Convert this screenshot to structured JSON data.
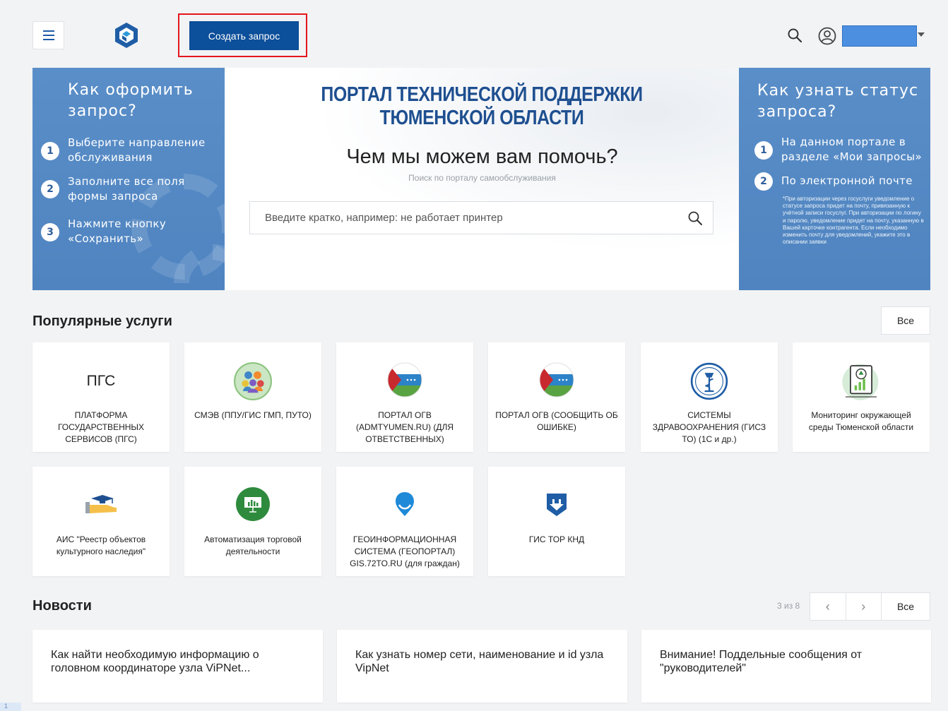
{
  "header": {
    "create_label": "Создать запрос"
  },
  "banner": {
    "left_title": "Как оформить запрос?",
    "left_steps": [
      {
        "num": "1",
        "text": "Выберите направление обслуживания"
      },
      {
        "num": "2",
        "text": "Заполните все поля формы запроса"
      },
      {
        "num": "3",
        "text": "Нажмите кнопку «Сохранить»"
      }
    ],
    "portal_title": "ПОРТАЛ ТЕХНИЧЕСКОЙ ПОДДЕРЖКИ ТЮМЕНСКОЙ ОБЛАСТИ",
    "help_title": "Чем мы можем вам помочь?",
    "help_sub": "Поиск по порталу самообслуживания",
    "search_placeholder": "Введите кратко, например: не работает принтер",
    "right_title": "Как узнать статус запроса?",
    "right_steps": [
      {
        "num": "1",
        "text": "На данном портале в разделе «Мои запросы»"
      },
      {
        "num": "2",
        "text": "По электронной почте"
      }
    ],
    "right_note": "*При авторизации через госуслуги уведомление о статусе запроса придет на почту, привязанную к учётной записи госуслуг. При авторизации по логину и паролю, уведомление придет на почту, указанную в Вашей карточке контрагента. Если необходимо изменить почту для уведомлений, укажите это в описании заявки"
  },
  "popular": {
    "title": "Популярные услуги",
    "all_label": "Все",
    "cards": [
      {
        "label": "ПЛАТФОРМА ГОСУДАРСТВЕННЫХ СЕРВИСОВ (ПГС)",
        "icon_text": "ПГС",
        "icon": "pgs-text-icon"
      },
      {
        "label": "СМЭВ (ППУ/ГИС ГМП, ПУТО)",
        "icon": "people-group-icon"
      },
      {
        "label": "ПОРТАЛ ОГВ (ADMTYUMEN.RU) (ДЛЯ ОТВЕТСТВЕННЫХ)",
        "icon": "flag-icon"
      },
      {
        "label": "ПОРТАЛ ОГВ (СООБЩИТЬ ОБ ОШИБКЕ)",
        "icon": "flag-icon"
      },
      {
        "label": "СИСТЕМЫ ЗДРАВООХРАНЕНИЯ (ГИСЗ ТО) (1С и др.)",
        "icon": "medical-icon"
      },
      {
        "label": "Мониторинг окружающей среды Тюменской области",
        "icon": "eco-monitor-icon"
      },
      {
        "label": "АИС \"Реестр объектов культурного наследия\"",
        "icon": "heritage-icon"
      },
      {
        "label": "Автоматизация торговой деятельности",
        "icon": "presentation-chart-icon"
      },
      {
        "label": "ГЕОИНФОРМАЦИОННАЯ СИСТЕМА (ГЕОПОРТАЛ) GIS.72TO.RU (для граждан)",
        "icon": "geo-pin-icon"
      },
      {
        "label": "ГИС ТОР КНД",
        "icon": "shield-arrow-icon"
      }
    ]
  },
  "news": {
    "title": "Новости",
    "pager_count": "3 из 8",
    "prev": "‹",
    "next": "›",
    "all_label": "Все",
    "items": [
      {
        "text": "Как найти необходимую информацию о головном координаторе узла ViPNet..."
      },
      {
        "text": "Как узнать номер сети, наименование и id узла VipNet"
      },
      {
        "text": "Внимание! Поддельные сообщения от \"руководителей\""
      }
    ]
  },
  "corner": "1"
}
